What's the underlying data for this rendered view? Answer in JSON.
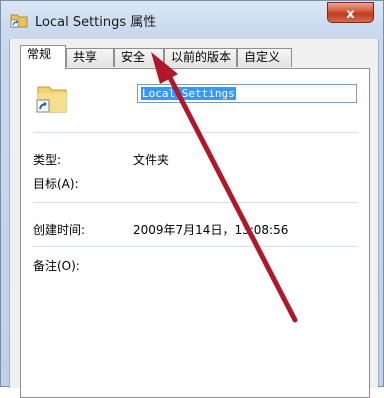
{
  "window": {
    "title": "Local Settings 属性",
    "close_label": "x"
  },
  "tabs": [
    {
      "label": "常规"
    },
    {
      "label": "共享"
    },
    {
      "label": "安全"
    },
    {
      "label": "以前的版本"
    },
    {
      "label": "自定义"
    }
  ],
  "general": {
    "name_value": "Local Settings",
    "type_label": "类型:",
    "type_value": "文件夹",
    "target_label": "目标(A):",
    "created_label": "创建时间:",
    "created_value": "2009年7月14日，13:08:56",
    "note_label": "备注(O):"
  },
  "colors": {
    "selection": "#3399ff",
    "arrow": "#b0182a",
    "close_button": "#c03a1d"
  },
  "icons": {
    "title": "folder-shortcut-icon",
    "main": "folder-shortcut-icon",
    "annotation": "red-arrow"
  }
}
